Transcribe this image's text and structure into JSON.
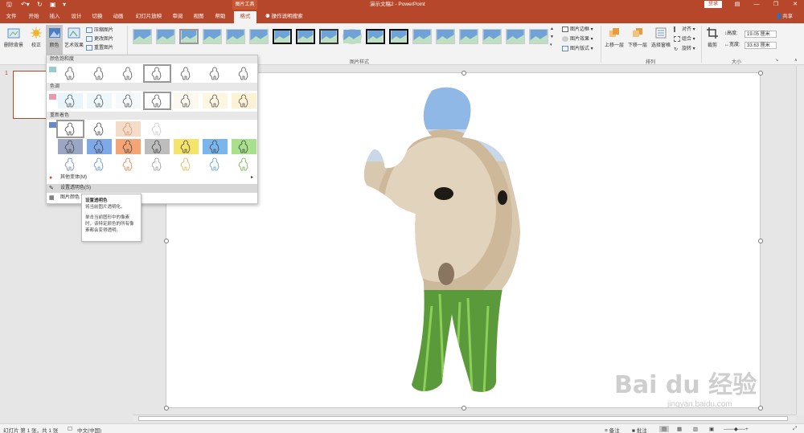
{
  "window": {
    "doc_title": "演示文稿2  -  PowerPoint",
    "context_tools": "图片工具",
    "login": "登录",
    "share": "共享"
  },
  "tabs": [
    "文件",
    "开始",
    "插入",
    "设计",
    "切换",
    "动画",
    "幻灯片放映",
    "审阅",
    "视图",
    "帮助",
    "格式"
  ],
  "tell_me": "操作说明搜索",
  "ribbon": {
    "remove_bg": "删除背景",
    "corrections": "校正",
    "color": "颜色",
    "artistic": "艺术效果",
    "compress": "压缩图片",
    "change_pic": "更改图片",
    "reset_pic": "重置图片",
    "styles_group": "图片样式",
    "pic_border": "图片边框",
    "pic_effects": "图片效果",
    "pic_layout": "图片版式",
    "bring_forward": "上移一层",
    "send_backward": "下移一层",
    "selection_pane": "选择窗格",
    "align": "对齐",
    "group": "组合",
    "rotate": "旋转",
    "arrange_group": "排列",
    "crop": "裁剪",
    "height_label": "高度:",
    "height_value": "19.05 厘米",
    "width_label": "宽度:",
    "width_value": "33.63 厘米",
    "size_group": "大小"
  },
  "color_menu": {
    "saturation": "颜色饱和度",
    "tone": "色调",
    "recolor": "重新着色",
    "more_variations": "其他变体(M)",
    "set_transparent": "设置透明色(S)",
    "picture_color_options": "图片颜色"
  },
  "tooltip": {
    "title": "设置透明色",
    "line1": "将当前图片透明化。",
    "line2": "单击当前图形中的像素时，该特定颜色的所有像素都会变得透明。"
  },
  "thumbnails": {
    "slide_number": "1"
  },
  "status": {
    "slide_info": "幻灯片 第 1 张，共 1 张",
    "language": "中文(中国)",
    "notes": "备注",
    "comments": "批注"
  },
  "watermark": {
    "main": "Bai du 经验",
    "sub": "jingyan.baidu.com"
  },
  "colors": {
    "accent": "#b7472a",
    "ribbon_bg": "#f3f3f3"
  }
}
